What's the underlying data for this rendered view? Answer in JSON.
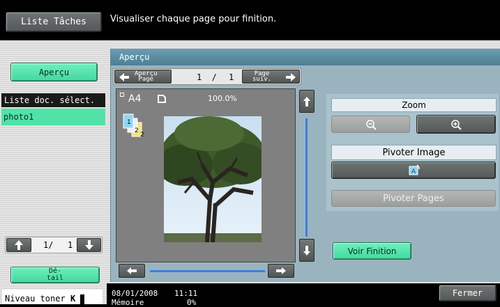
{
  "top": {
    "task_list_label": "Liste Tâches",
    "message": "Visualiser chaque page pour finition."
  },
  "sidebar": {
    "preview_label": "Aperçu",
    "doc_list_header": "Liste doc. sélect.",
    "doc_items": [
      "photo1"
    ],
    "page_current": "1/",
    "page_total": "1",
    "detail_label": "Dé-\ntail",
    "toner_label": "Niveau toner"
  },
  "panel": {
    "title": "Aperçu",
    "prev_page_label": "Aperçu\nPage",
    "page_indicator": "1  /",
    "page_input": "1",
    "next_page_label": "Page\nsuiv.",
    "paper_size": "A4",
    "zoom_percent": "100.0%",
    "zoom_label": "Zoom",
    "rotate_image_label": "Pivoter Image",
    "rotate_pages_label": "Pivoter Pages",
    "finish_label": "Voir Finition"
  },
  "status": {
    "date": "08/01/2008",
    "time": "11:11",
    "memory_label": "Mémoire",
    "memory_value": "0%",
    "close_label": "Fermer"
  },
  "colors": {
    "accent_green": "#4fe3a8",
    "panel_teal": "#5b8fa6",
    "selection_blue": "#3a7fe0"
  }
}
